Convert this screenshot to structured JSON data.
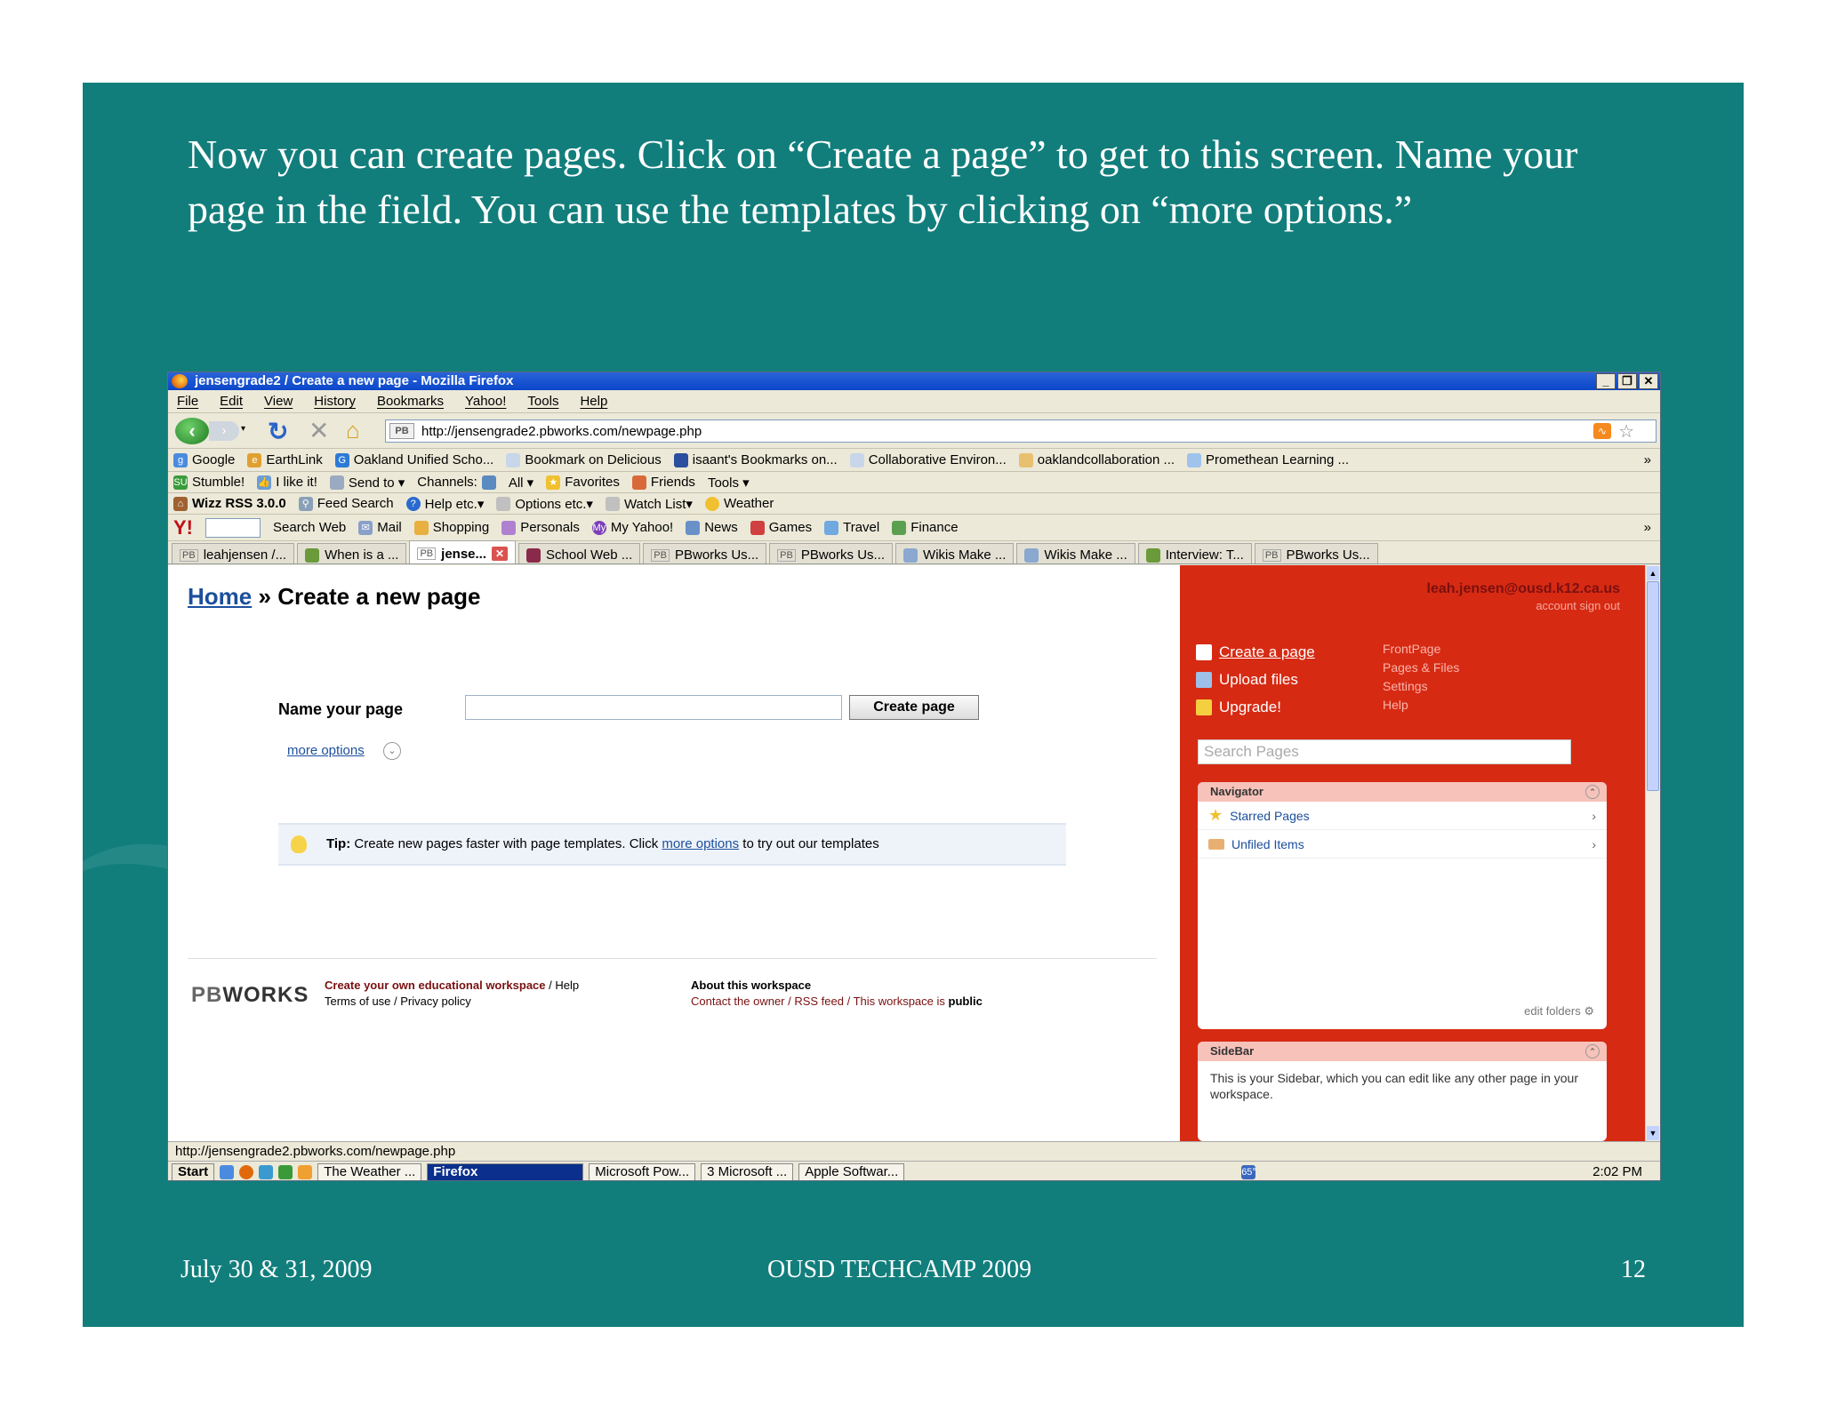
{
  "slide": {
    "title": "Now you can create pages.  Click on “Create a page” to get to this screen.  Name your page in the field.  You can use the templates by clicking on “more options.”",
    "footer_left": "July 30 & 31, 2009",
    "footer_center": "OUSD TECHCAMP 2009",
    "footer_right": "12"
  },
  "window": {
    "title": "jensengrade2 / Create a new page - Mozilla Firefox",
    "buttons": [
      "_",
      "❐",
      "✕"
    ]
  },
  "menu": [
    "File",
    "Edit",
    "View",
    "History",
    "Bookmarks",
    "Yahoo!",
    "Tools",
    "Help"
  ],
  "address": {
    "badge": "PB",
    "url": "http://jensengrade2.pbworks.com/newpage.php"
  },
  "bookmarks": [
    "Google",
    "EarthLink",
    "Oakland Unified Scho...",
    "Bookmark on Delicious",
    "isaant's Bookmarks on...",
    "Collaborative Environ...",
    "oaklandcollaboration ...",
    "Promethean Learning ...",
    "»"
  ],
  "stumble_bar": [
    "Stumble!",
    "I like it!",
    "Send to ▾",
    "Channels:",
    "All ▾",
    "Favorites",
    "Friends",
    "Tools ▾"
  ],
  "wizz_bar": [
    "Wizz RSS 3.0.0",
    "Feed Search",
    "Help etc.▾",
    "Options etc.▾",
    "Watch List▾",
    "Weather"
  ],
  "yahoo_bar": [
    "Y!",
    "Search Web",
    "Mail",
    "Shopping",
    "Personals",
    "My Yahoo!",
    "News",
    "Games",
    "Travel",
    "Finance",
    "»"
  ],
  "tabs": [
    {
      "label": "leahjensen /...",
      "badge": "PB"
    },
    {
      "label": "When is a ...",
      "badge": ""
    },
    {
      "label": "jense...",
      "badge": "PB"
    },
    {
      "label": "School Web ...",
      "badge": ""
    },
    {
      "label": "PBworks Us...",
      "badge": "PB"
    },
    {
      "label": "PBworks Us...",
      "badge": "PB"
    },
    {
      "label": "Wikis Make ...",
      "badge": ""
    },
    {
      "label": "Wikis Make ...",
      "badge": ""
    },
    {
      "label": "Interview: T...",
      "badge": ""
    },
    {
      "label": "PBworks Us...",
      "badge": "PB"
    }
  ],
  "page": {
    "crumb_home": "Home",
    "crumb_sep": "»",
    "crumb_current": "Create a new page",
    "name_label": "Name your page",
    "name_value": "",
    "create_button": "Create page",
    "more_options": "more options",
    "tip_bold": "Tip:",
    "tip_text": "Create new pages faster with page templates. Click",
    "tip_link": "more options",
    "tip_end": "to try out our templates",
    "logo_pb": "PB",
    "logo_works": "WORKS",
    "foot1_link": "Create your own educational workspace",
    "foot1_help": "/ Help",
    "foot1_line2": "Terms of use / Privacy policy",
    "foot2_head": "About this workspace",
    "foot2_line2": "Contact the owner / RSS feed / This workspace is",
    "foot2_public": "public"
  },
  "sidebar": {
    "email": "leah.jensen@ousd.k12.ca.us",
    "account": "account   sign out",
    "actions": [
      "Create a page",
      "Upload files",
      "Upgrade!"
    ],
    "links": [
      "FrontPage",
      "Pages & Files",
      "Settings",
      "Help"
    ],
    "search_placeholder": "Search Pages",
    "navigator_title": "Navigator",
    "nav_items": [
      "Starred Pages",
      "Unfiled Items"
    ],
    "edit_folders": "edit folders",
    "sidebar_title": "SideBar",
    "sidebar_text": "This is your Sidebar, which you can edit like any other page in your workspace."
  },
  "status": "http://jensengrade2.pbworks.com/newpage.php",
  "taskbar": {
    "start": "Start",
    "items": [
      "The Weather ...",
      "Firefox",
      "Microsoft Pow...",
      "3 Microsoft ...",
      "Apple Softwar..."
    ],
    "temp": "65°",
    "clock": "2:02 PM"
  },
  "colors": {
    "slide_bg": "#127e7c",
    "sidebar_red": "#d72a13",
    "link_blue": "#1c4f9c"
  }
}
